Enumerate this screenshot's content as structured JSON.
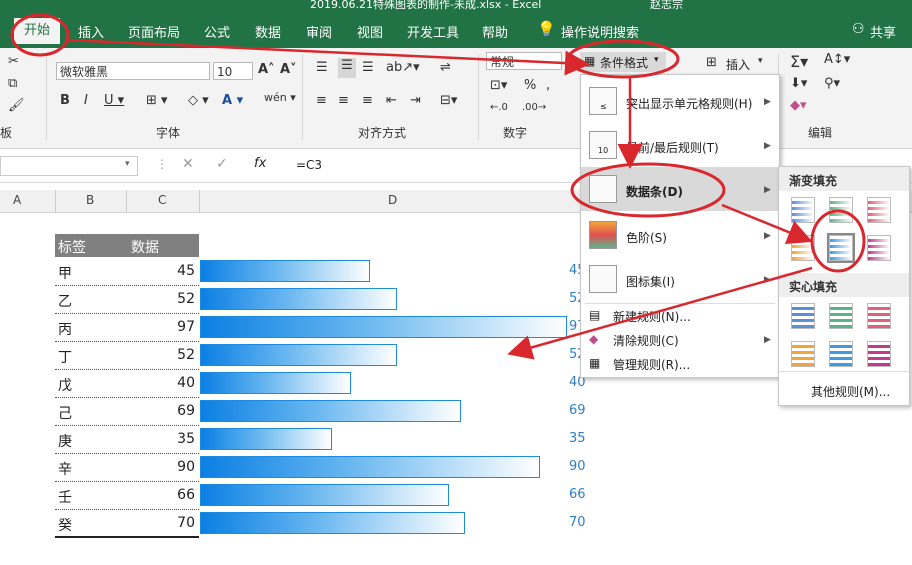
{
  "titlebar": {
    "title": "2019.06.21特殊图表的制作-未成.xlsx - Excel",
    "user": "赵志宗"
  },
  "tabs": [
    "开始",
    "插入",
    "页面布局",
    "公式",
    "数据",
    "审阅",
    "视图",
    "开发工具",
    "帮助",
    "操作说明搜索"
  ],
  "share": "共享",
  "ribbon": {
    "font_name": "微软雅黑",
    "font_size": "10",
    "number_format": "常规",
    "groups": {
      "font": "字体",
      "align": "对齐方式",
      "number": "数字",
      "edit": "编辑",
      "clip": "板"
    },
    "cond_format_btn": "条件格式",
    "insert_btn": "插入"
  },
  "formula": {
    "content": "=C3",
    "fx": "fx"
  },
  "columns": [
    "A",
    "B",
    "C",
    "D"
  ],
  "table": {
    "header": {
      "label": "标签",
      "value": "数据"
    },
    "rows": [
      {
        "label": "甲",
        "value": 45
      },
      {
        "label": "乙",
        "value": 52
      },
      {
        "label": "丙",
        "value": 97
      },
      {
        "label": "丁",
        "value": 52
      },
      {
        "label": "戊",
        "value": 40
      },
      {
        "label": "己",
        "value": 69
      },
      {
        "label": "庚",
        "value": 35
      },
      {
        "label": "辛",
        "value": 90
      },
      {
        "label": "壬",
        "value": 66
      },
      {
        "label": "癸",
        "value": 70
      }
    ],
    "d_values": [
      "45",
      "52",
      "97",
      "52",
      "40",
      "69",
      "35",
      "90",
      "66",
      "70"
    ],
    "bar_max": 100
  },
  "cond_menu": {
    "items": [
      {
        "label": "突出显示单元格规则(H)",
        "icon": "highlight-rules-icon"
      },
      {
        "label": "最前/最后规则(T)",
        "icon": "top-bottom-icon"
      },
      {
        "label": "数据条(D)",
        "icon": "databar-icon"
      },
      {
        "label": "色阶(S)",
        "icon": "color-scale-icon"
      },
      {
        "label": "图标集(I)",
        "icon": "icon-set-icon"
      }
    ],
    "small_items": [
      "新建规则(N)...",
      "清除规则(C)",
      "管理规则(R)..."
    ]
  },
  "databar_menu": {
    "gradient_title": "渐变填充",
    "solid_title": "实心填充",
    "more": "其他规则(M)...",
    "colors": [
      "#5b8fd8",
      "#5cb38a",
      "#e0607a",
      "#f2a33a",
      "#3d9be0",
      "#c23b8a"
    ]
  },
  "annotation_color": "#d9272e"
}
